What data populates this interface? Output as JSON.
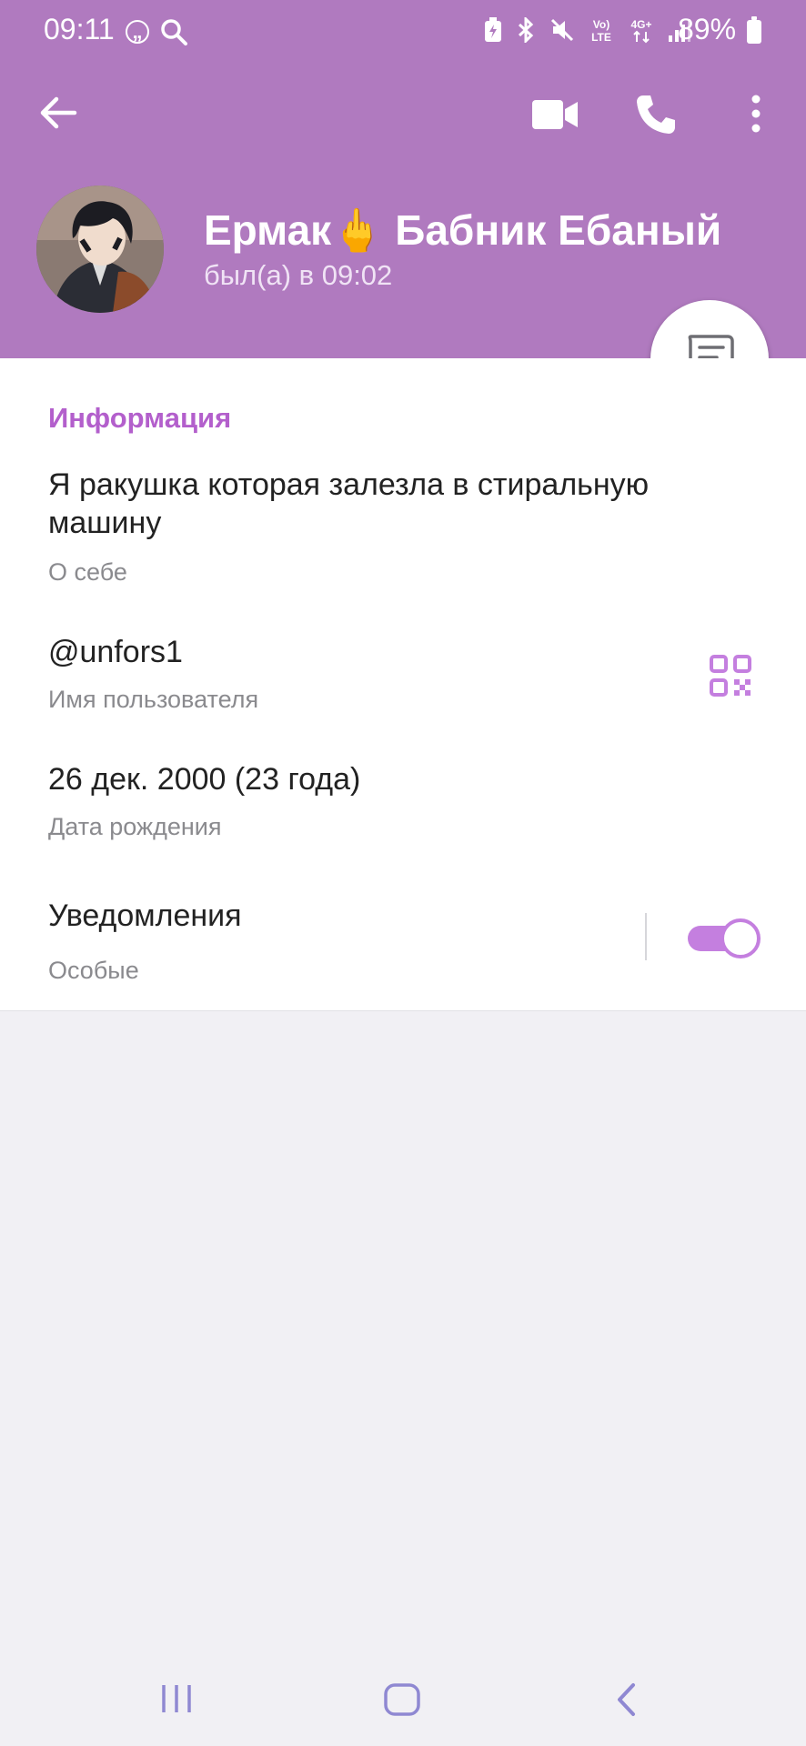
{
  "status_bar": {
    "time": "09:11",
    "battery": "89%",
    "icons": [
      "quote-icon",
      "search-icon",
      "battery-saver-icon",
      "bluetooth-icon",
      "mute-icon",
      "volte-icon",
      "4g-icon",
      "signal-icon",
      "battery-icon"
    ]
  },
  "toolbar": {
    "back_icon": "arrow-left-icon",
    "video_icon": "video-call-icon",
    "call_icon": "phone-icon",
    "more_icon": "more-vertical-icon"
  },
  "profile": {
    "name": "Ермак🖕 Бабник Ебаный",
    "status": "был(а) в 09:02"
  },
  "info": {
    "section_title": "Информация",
    "bio_text": "Я ракушка которая залезла в стиральную машину",
    "bio_label": "О себе",
    "username": "@unfors1",
    "username_label": "Имя пользователя",
    "birthday": "26 дек. 2000 (23 года)",
    "birthday_label": "Дата рождения",
    "notifications": "Уведомления",
    "notifications_label": "Особые",
    "notifications_enabled": true
  },
  "colors": {
    "header": "#b07abf",
    "accent": "#b35fcc",
    "toggle": "#c47fdf",
    "background": "#f1f0f4"
  },
  "nav_bar": {
    "icons": [
      "recent-apps-icon",
      "home-icon",
      "back-nav-icon"
    ]
  }
}
